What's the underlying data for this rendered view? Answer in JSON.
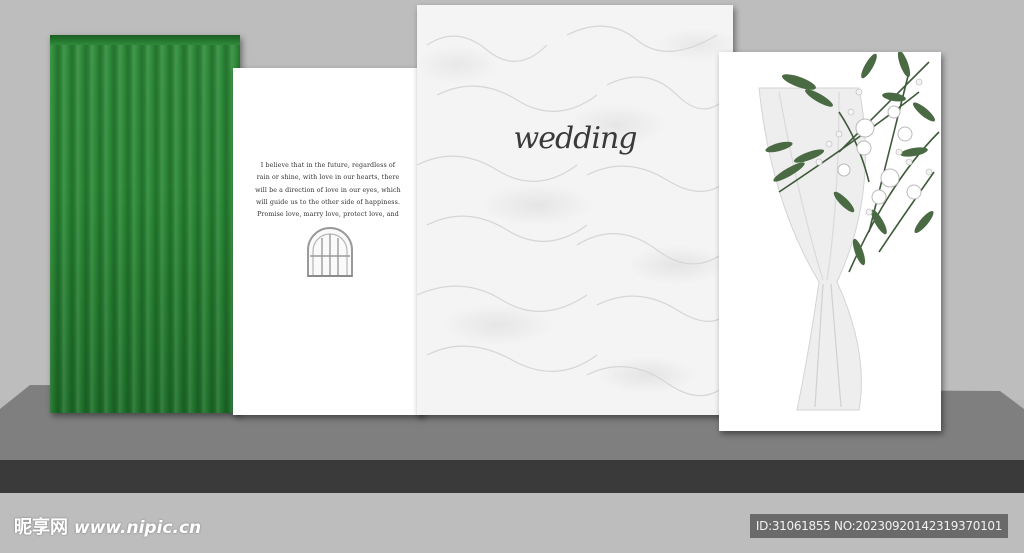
{
  "scene": {
    "title_text": "wedding",
    "quote_lines": [
      "I believe that in the future, regardless of",
      "rain or shine, with love in our hearts, there",
      "will be a direction of love in our eyes, which",
      "will guide us to the other side of happiness.",
      "Promise love, marry love, protect love, and"
    ],
    "colors": {
      "wall": "#bdbdbd",
      "stage_top": "#808080",
      "stage_front": "#3a3a3a",
      "curtain_green": "#2a8735",
      "panel_white": "#ffffff",
      "foliage": "#3f5a3a"
    },
    "icons": [
      "arched-window-icon",
      "flower-bouquet-icon",
      "draped-curtain-icon"
    ]
  },
  "watermark": {
    "brand": "昵享网",
    "url": "www.nipic.cn",
    "id_text": "ID:31061855 NO:20230920142319370101"
  }
}
